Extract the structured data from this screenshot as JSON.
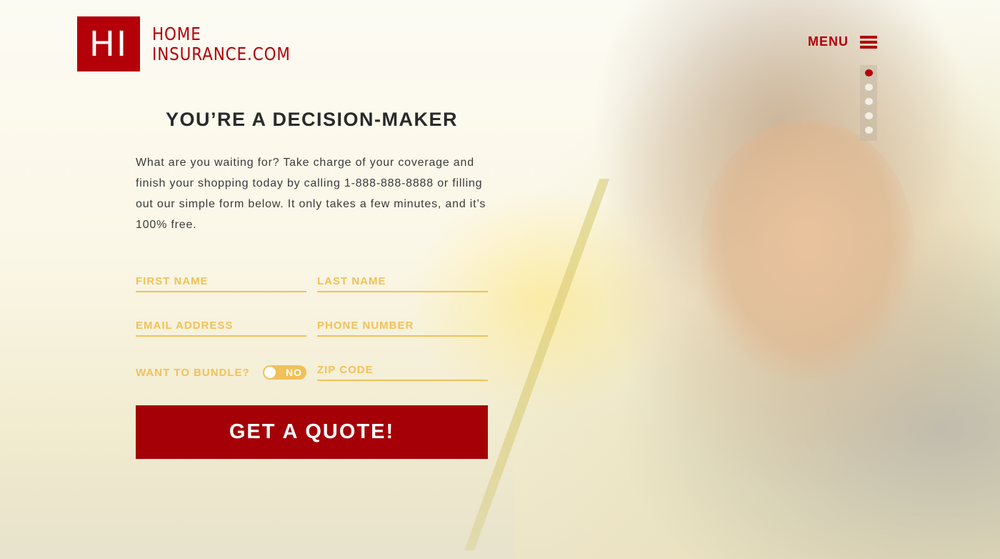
{
  "brand": {
    "logo_mark": "HI",
    "name_line1": "HOME",
    "name_line2": "INSURANCE.COM"
  },
  "nav": {
    "menu_label": "MENU",
    "slides": {
      "count": 5,
      "active_index": 0
    }
  },
  "main": {
    "headline": "YOU’RE A DECISION-MAKER",
    "intro": "What are you waiting for? Take charge of your coverage and finish your shopping today by calling 1-888-888-8888 or filling out our simple form below. It only takes a few minutes, and it’s 100% free."
  },
  "form": {
    "first_name": {
      "placeholder": "FIRST NAME",
      "value": ""
    },
    "last_name": {
      "placeholder": "LAST NAME",
      "value": ""
    },
    "email": {
      "placeholder": "EMAIL ADDRESS",
      "value": ""
    },
    "phone": {
      "placeholder": "PHONE NUMBER",
      "value": ""
    },
    "bundle": {
      "label": "WANT TO BUNDLE?",
      "state": "NO"
    },
    "zip": {
      "placeholder": "ZIP CODE",
      "value": ""
    },
    "submit_label": "GET A QUOTE!"
  },
  "colors": {
    "brand_red": "#b30009",
    "button_red": "#a50007",
    "field_accent": "#f0c158",
    "heading_text": "#2a2a2a"
  }
}
